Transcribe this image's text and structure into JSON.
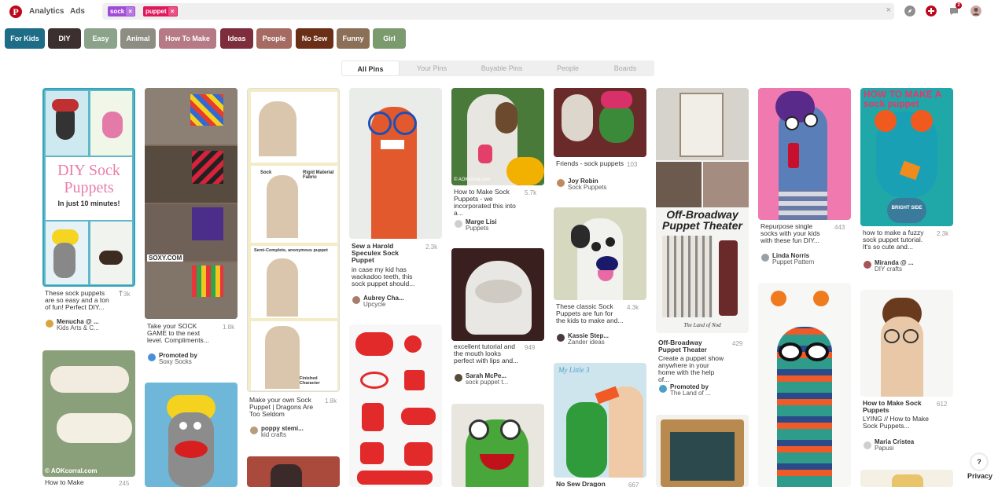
{
  "header": {
    "logo": "P",
    "nav": [
      "Analytics",
      "Ads"
    ],
    "search_chips": [
      {
        "label": "sock",
        "color": "#a14cd8"
      },
      {
        "label": "puppet",
        "color": "#e0195c"
      }
    ],
    "clear_icon": "×",
    "notif_count": "2"
  },
  "guides": [
    {
      "label": "For Kids",
      "color": "#1d6d86"
    },
    {
      "label": "DIY",
      "color": "#3b2f2f"
    },
    {
      "label": "Easy",
      "color": "#8aa38a"
    },
    {
      "label": "Animal",
      "color": "#8d8d84"
    },
    {
      "label": "How To Make",
      "color": "#b57a85"
    },
    {
      "label": "Ideas",
      "color": "#7e2d3d"
    },
    {
      "label": "People",
      "color": "#a56b63"
    },
    {
      "label": "No Sew",
      "color": "#6b2e17"
    },
    {
      "label": "Funny",
      "color": "#8b6f57"
    },
    {
      "label": "Girl",
      "color": "#7b9b6f"
    }
  ],
  "tabs": [
    "All Pins",
    "Your Pins",
    "Buyable Pins",
    "People",
    "Boards"
  ],
  "pins": [
    {
      "desc": "These sock puppets are so easy and a ton of fun! Perfect DIY...",
      "saves": "3k",
      "user": "Menucha @ ...",
      "board": "Kids Arts & C...",
      "overlay": "DIY Sock Puppets",
      "overlay2": "In just 10 minutes!"
    },
    {
      "desc": "How to Make",
      "saves": "245",
      "overlay": "© AOKcorral.com"
    },
    {
      "desc": "Take your SOCK GAME to the next level. Compliments...",
      "saves": "1.8k",
      "user": "Promoted by",
      "board": "Soxy Socks",
      "overlay": "SOXY.COM"
    },
    {
      "desc": "Make your own Sock Puppet | Dragons Are Too Seldom",
      "saves": "1.8k",
      "user": "poppy stemi...",
      "board": "kid crafts",
      "labels": [
        "Sock",
        "Rigid Material Fabric",
        "Semi-Complete, anonymous puppet",
        "Finished Character"
      ]
    },
    {
      "title": "Sew a Harold Speculex Sock Puppet",
      "desc": "in case my kid has wackadoo teeth, this sock puppet should...",
      "saves": "2.3k",
      "user": "Aubrey Cha...",
      "board": "Upcycle"
    },
    {
      "desc": "How to Make Sock Puppets - we incorporated this into a...",
      "saves": "5.7k",
      "user": "Marge Lisi",
      "board": "Puppets",
      "overlay": "© AOKcorral.com"
    },
    {
      "desc": "excellent tutorial and the mouth looks perfect with lips and...",
      "saves": "949",
      "user": "Sarah McPe...",
      "board": "sock puppet t..."
    },
    {
      "desc": "Friends - sock puppets",
      "saves": "103",
      "user": "Joy Robin",
      "board": "Sock Puppets"
    },
    {
      "desc": "These classic Sock Puppets are fun for the kids to make and...",
      "saves": "4.3k",
      "user": "Kassie Step...",
      "board": "Zander ideas"
    },
    {
      "title": "No Sew Dragon",
      "saves": "667",
      "overlay": "My Little 3"
    },
    {
      "title": "Off-Broadway Puppet Theater",
      "desc": "Create a puppet show anywhere in your home with the help of...",
      "saves": "429",
      "user": "Promoted by",
      "board": "The Land of ...",
      "overlay": "Off-Broadway Puppet Theater",
      "overlay2": "The Land of Nod"
    },
    {
      "desc": "Repurpose single socks with your kids with these fun DIY...",
      "saves": "443",
      "user": "Linda Norris",
      "board": "Puppet Pattern"
    },
    {
      "desc": "how to make a fuzzy sock puppet tutorial. It's so cute and...",
      "saves": "2.3k",
      "user": "Miranda @ ...",
      "board": "DIY crafts",
      "overlay": "HOW TO MAKE A sock puppet",
      "overlay2": "BRIGHT SIDE"
    },
    {
      "title": "How to Make Sock Puppets",
      "desc": "LYING // How to Make Sock Puppets...",
      "saves": "612",
      "user": "Maria Cristea",
      "board": "Papusi"
    }
  ],
  "help": "?",
  "privacy": "Privacy"
}
